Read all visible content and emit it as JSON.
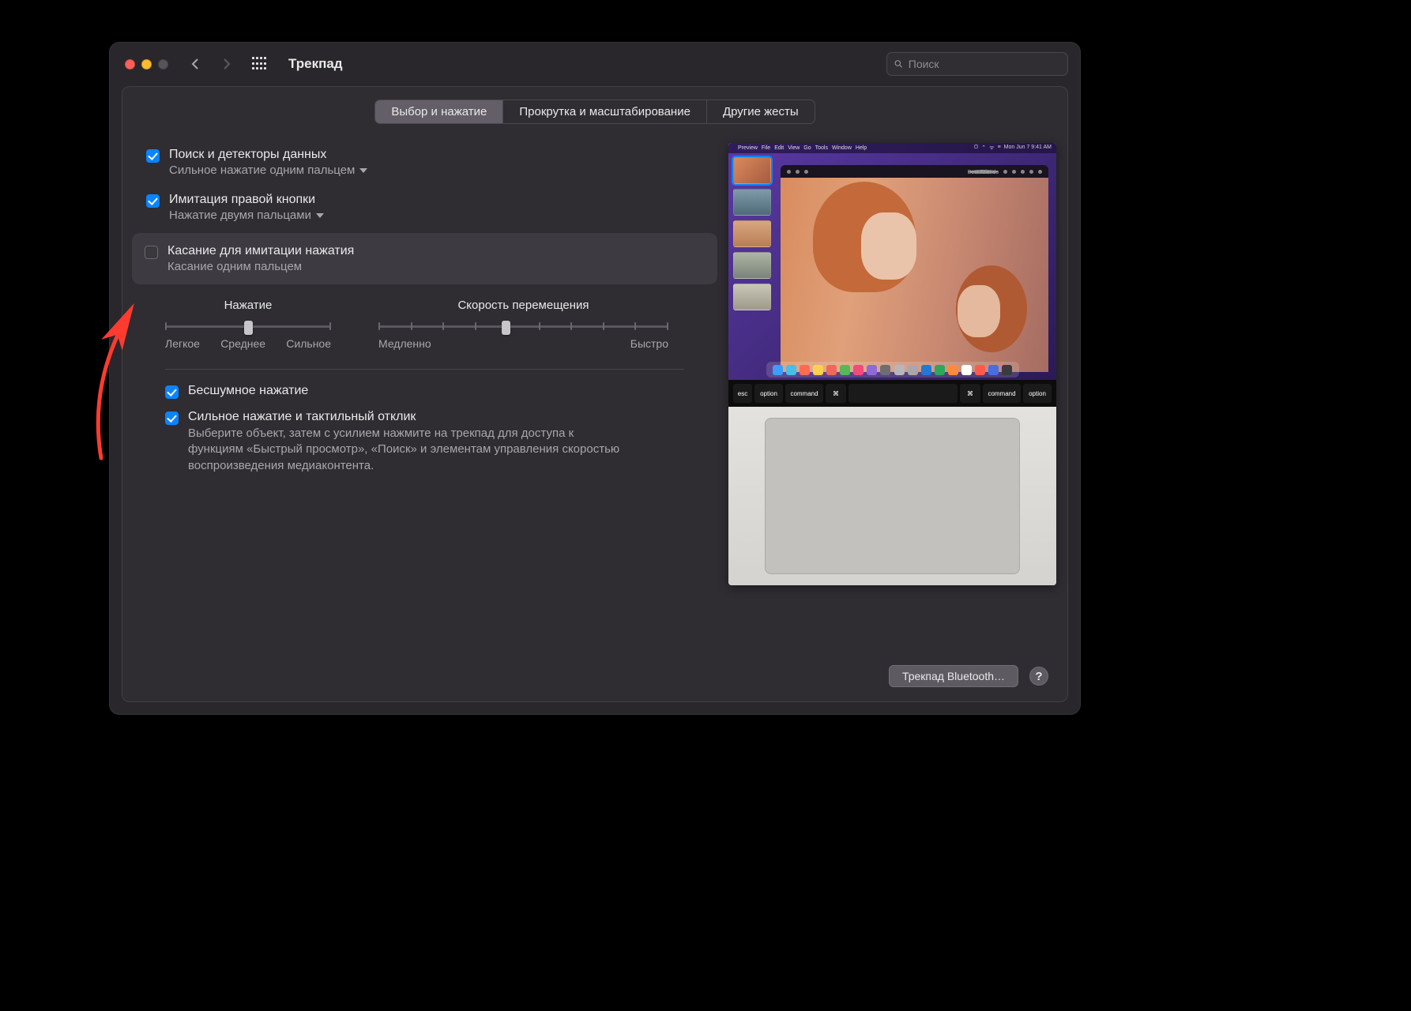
{
  "title": "Трекпад",
  "search_placeholder": "Поиск",
  "tabs": {
    "point_click": "Выбор и нажатие",
    "scroll_zoom": "Прокрутка и масштабирование",
    "more_gestures": "Другие жесты"
  },
  "options": {
    "lookup": {
      "label": "Поиск и детекторы данных",
      "sub": "Сильное нажатие одним пальцем",
      "checked": true
    },
    "secondary": {
      "label": "Имитация правой кнопки",
      "sub": "Нажатие двумя пальцами",
      "checked": true
    },
    "tap": {
      "label": "Касание для имитации нажатия",
      "sub": "Касание одним пальцем",
      "checked": false
    },
    "silent": {
      "label": "Бесшумное нажатие",
      "checked": true
    },
    "force": {
      "label": "Сильное нажатие и тактильный отклик",
      "desc": "Выберите объект, затем с усилием нажмите на трекпад для доступа к функциям «Быстрый просмотр», «Поиск» и элементам управления скоростью воспроизведения медиаконтента.",
      "checked": true
    }
  },
  "sliders": {
    "click": {
      "title": "Нажатие",
      "labels": [
        "Легкое",
        "Среднее",
        "Сильное"
      ],
      "value": 1,
      "steps": 3
    },
    "speed": {
      "title": "Скорость перемещения",
      "labels": [
        "Медленно",
        "Быстро"
      ],
      "value": 4,
      "steps": 10
    }
  },
  "footer": {
    "bt_button": "Трекпад Bluetooth…",
    "help": "?"
  },
  "preview_menubar": {
    "apple": "",
    "menus": [
      "Preview",
      "File",
      "Edit",
      "View",
      "Go",
      "Tools",
      "Window",
      "Help"
    ],
    "status": [
      "⏻",
      "⌃",
      "ᯤ",
      "≡",
      "Mon Jun 7  9:41 AM"
    ]
  },
  "preview_keys": [
    "esc",
    "option",
    "command",
    "⌘",
    "",
    "",
    "⌘",
    "command",
    "option"
  ],
  "dock_colors": [
    "#3b9dff",
    "#4abde8",
    "#ff6a55",
    "#ffd14a",
    "#f2675a",
    "#57b858",
    "#f24a7b",
    "#8f6ad6",
    "#6e6e72",
    "#b7b7bb",
    "#a7a7ac",
    "#2378d6",
    "#2ba85c",
    "#ff8a3c",
    "#ffffff",
    "#ff5a4e",
    "#4a6de3",
    "#3b3b3f"
  ]
}
